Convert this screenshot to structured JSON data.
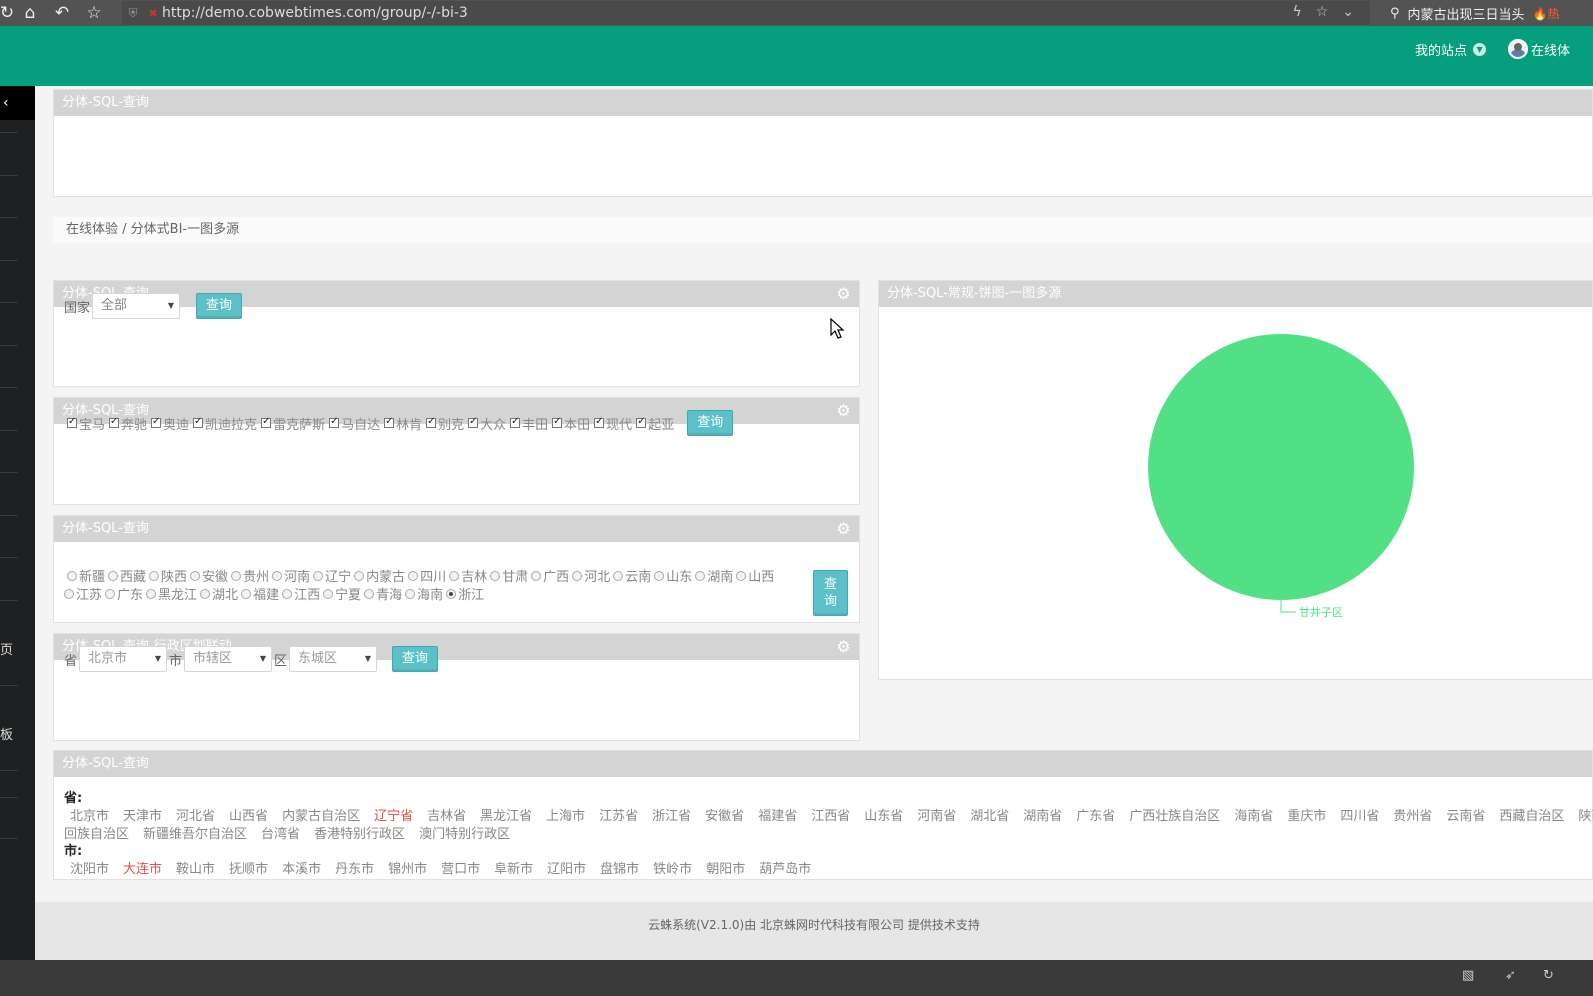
{
  "browser": {
    "url": "http://demo.cobwebtimes.com/group/-/-bi-3",
    "search_text": "内蒙古出现三日当头",
    "hot_label": "热"
  },
  "header": {
    "my_site": "我的站点",
    "user": "在线体"
  },
  "sidebar": {
    "labels": [
      "页",
      "板"
    ]
  },
  "top_panel": {
    "title": "分体-SQL-查询"
  },
  "breadcrumb": "在线体验 / 分体式BI-一图多源",
  "panel_country": {
    "title": "分体-SQL-查询",
    "label": "国家",
    "select_value": "全部",
    "query_button": "查询"
  },
  "panel_brands": {
    "title": "分体-SQL-查询",
    "brands": [
      "宝马",
      "奔驰",
      "奥迪",
      "凯迪拉克",
      "雷克萨斯",
      "马自达",
      "林肯",
      "别克",
      "大众",
      "丰田",
      "本田",
      "现代",
      "起亚"
    ],
    "query_button": "查询"
  },
  "panel_provinces": {
    "title": "分体-SQL-查询",
    "row1": [
      "新疆",
      "西藏",
      "陕西",
      "安徽",
      "贵州",
      "河南",
      "辽宁",
      "内蒙古",
      "四川",
      "吉林",
      "甘肃",
      "广西",
      "河北",
      "云南",
      "山东",
      "湖南",
      "山西"
    ],
    "row2": [
      "江苏",
      "广东",
      "黑龙江",
      "湖北",
      "福建",
      "江西",
      "宁夏",
      "青海",
      "海南",
      "浙江"
    ],
    "selected": "浙江",
    "query_button_top": "查",
    "query_button_bottom": "询"
  },
  "panel_admin": {
    "title": "分体-SQL-查询-行政区划联动",
    "province_label": "省",
    "province_value": "北京市",
    "city_label": "市",
    "city_value": "市辖区",
    "district_label": "区",
    "district_value": "东城区",
    "query_button": "查询"
  },
  "panel_pie": {
    "title": "分体-SQL-常规-饼图-一图多源"
  },
  "chart_data": {
    "type": "pie",
    "categories": [
      "甘井子区"
    ],
    "values": [
      100
    ],
    "colors": [
      "#52e087"
    ],
    "title": ""
  },
  "panel_region": {
    "title": "分体-SQL-查询",
    "province_heading": "省:",
    "provinces_line1": [
      "北京市",
      "天津市",
      "河北省",
      "山西省",
      "内蒙古自治区",
      "辽宁省",
      "吉林省",
      "黑龙江省",
      "上海市",
      "江苏省",
      "浙江省",
      "安徽省",
      "福建省",
      "江西省",
      "山东省",
      "河南省",
      "湖北省",
      "湖南省",
      "广东省",
      "广西壮族自治区",
      "海南省",
      "重庆市",
      "四川省",
      "贵州省",
      "云南省",
      "西藏自治区",
      "陕西省"
    ],
    "provinces_line2": [
      "回族自治区",
      "新疆维吾尔自治区",
      "台湾省",
      "香港特别行政区",
      "澳门特别行政区"
    ],
    "selected_province": "辽宁省",
    "city_heading": "市:",
    "cities": [
      "沈阳市",
      "大连市",
      "鞍山市",
      "抚顺市",
      "本溪市",
      "丹东市",
      "锦州市",
      "营口市",
      "阜新市",
      "辽阳市",
      "盘锦市",
      "铁岭市",
      "朝阳市",
      "葫芦岛市"
    ],
    "selected_city": "大连市"
  },
  "footer": "云蛛系统(V2.1.0)由 北京蛛网时代科技有限公司 提供技术支持"
}
